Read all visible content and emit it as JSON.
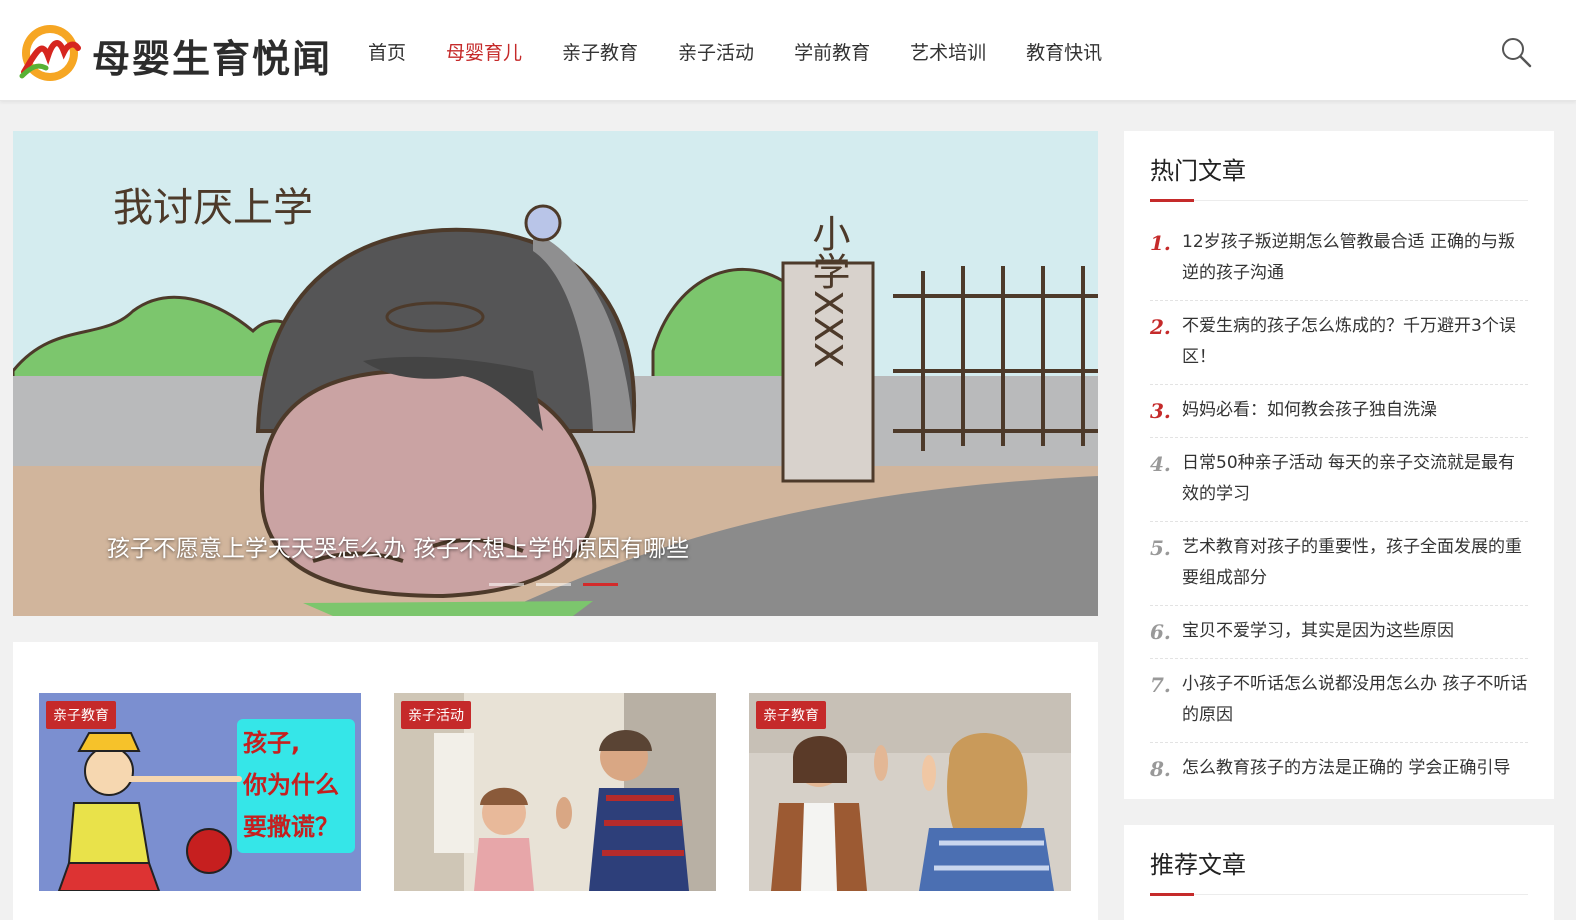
{
  "header": {
    "site_name": "母婴生育悦闻",
    "nav": [
      "首页",
      "母婴育儿",
      "亲子教育",
      "亲子活动",
      "学前教育",
      "艺术培训",
      "教育快讯"
    ],
    "active_nav_index": 1
  },
  "slider": {
    "image_text": "我讨厌上学",
    "sign_text": "小学XXX",
    "caption": "孩子不愿意上学天天哭怎么办 孩子不想上学的原因有哪些",
    "slide_count": 3,
    "active_slide": 3
  },
  "cards": [
    {
      "tag": "亲子教育",
      "image_text": [
        "孩子,",
        "你为什么",
        "要撒谎？"
      ]
    },
    {
      "tag": "亲子活动"
    },
    {
      "tag": "亲子教育"
    }
  ],
  "hot_articles": {
    "title": "热门文章",
    "items": [
      {
        "num": "1.",
        "text": "12岁孩子叛逆期怎么管教最合适 正确的与叛逆的孩子沟通"
      },
      {
        "num": "2.",
        "text": "不爱生病的孩子怎么炼成的？千万避开3个误区！"
      },
      {
        "num": "3.",
        "text": "妈妈必看：如何教会孩子独自洗澡"
      },
      {
        "num": "4.",
        "text": "日常50种亲子活动 每天的亲子交流就是最有效的学习"
      },
      {
        "num": "5.",
        "text": "艺术教育对孩子的重要性，孩子全面发展的重要组成部分"
      },
      {
        "num": "6.",
        "text": "宝贝不爱学习，其实是因为这些原因"
      },
      {
        "num": "7.",
        "text": "小孩子不听话怎么说都没用怎么办 孩子不听话的原因"
      },
      {
        "num": "8.",
        "text": "怎么教育孩子的方法是正确的 学会正确引导"
      }
    ]
  },
  "recommended": {
    "title": "推荐文章"
  },
  "colors": {
    "accent": "#c52a2a",
    "background": "#f1f1f1"
  }
}
